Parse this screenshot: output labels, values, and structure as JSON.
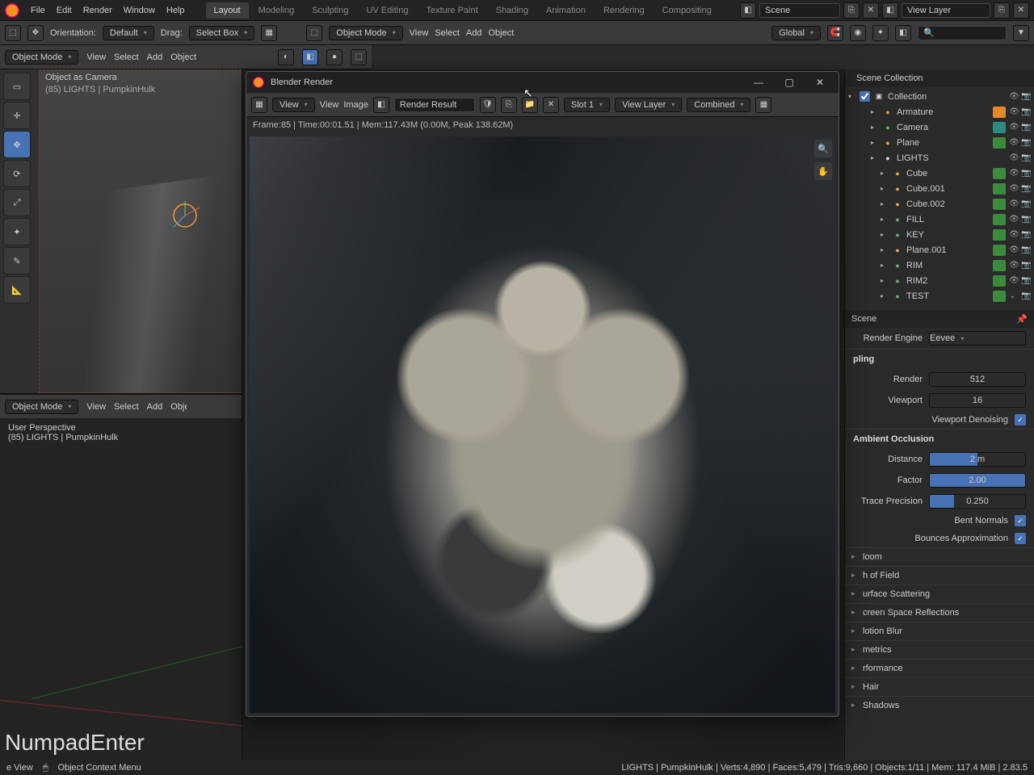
{
  "topmenu": {
    "file": "File",
    "edit": "Edit",
    "render": "Render",
    "window": "Window",
    "help": "Help"
  },
  "tabs": [
    "Layout",
    "Modeling",
    "Sculpting",
    "UV Editing",
    "Texture Paint",
    "Shading",
    "Animation",
    "Rendering",
    "Compositing"
  ],
  "scene_label": "Scene",
  "viewlayer_label": "View Layer",
  "header": {
    "orientation_label": "Orientation:",
    "default": "Default",
    "drag_label": "Drag:",
    "select_box": "Select Box",
    "object_mode": "Object Mode",
    "view": "View",
    "select": "Select",
    "add": "Add",
    "object": "Object",
    "global": "Global"
  },
  "modebar": {
    "object_mode": "Object Mode",
    "view": "View",
    "select": "Select",
    "add": "Add",
    "object": "Object"
  },
  "vp1": {
    "title": "Object as Camera",
    "sub": "(85) LIGHTS | PumpkinHulk"
  },
  "vp2": {
    "title": "User Perspective",
    "sub": "(85) LIGHTS | PumpkinHulk"
  },
  "key_indicator": "NumpadEnter",
  "render_window": {
    "title": "Blender Render",
    "view": "View",
    "view2": "View",
    "image": "Image",
    "render_result": "Render Result",
    "slot": "Slot 1",
    "layer": "View Layer",
    "pass": "Combined",
    "info": "Frame:85 | Time:00:01.51 | Mem:117.43M (0.00M, Peak 138.62M)"
  },
  "outliner": {
    "header": "Scene Collection",
    "collection": "Collection",
    "items": [
      {
        "name": "Armature",
        "icon": "arm",
        "indent": 2,
        "chip": "orange"
      },
      {
        "name": "Camera",
        "icon": "cam",
        "indent": 2,
        "chip": "teal"
      },
      {
        "name": "Plane",
        "icon": "mesh",
        "indent": 2,
        "chip": "green"
      },
      {
        "name": "LIGHTS",
        "icon": "coll",
        "indent": 2
      },
      {
        "name": "Cube",
        "icon": "mesh",
        "indent": 3,
        "chip": "green"
      },
      {
        "name": "Cube.001",
        "icon": "mesh",
        "indent": 3,
        "chip": "green"
      },
      {
        "name": "Cube.002",
        "icon": "mesh",
        "indent": 3,
        "chip": "green"
      },
      {
        "name": "FILL",
        "icon": "light",
        "indent": 3,
        "chip": "green"
      },
      {
        "name": "KEY",
        "icon": "light",
        "indent": 3,
        "chip": "green"
      },
      {
        "name": "Plane.001",
        "icon": "mesh",
        "indent": 3,
        "chip": "green"
      },
      {
        "name": "RIM",
        "icon": "light",
        "indent": 3,
        "chip": "green"
      },
      {
        "name": "RIM2",
        "icon": "light",
        "indent": 3,
        "chip": "green"
      },
      {
        "name": "TEST",
        "icon": "light",
        "indent": 3,
        "chip": "green"
      }
    ]
  },
  "props": {
    "scene": "Scene",
    "render_engine_label": "Render Engine",
    "render_engine": "Eevee",
    "sampling": "pling",
    "render_label": "Render",
    "render_val": "512",
    "viewport_label": "Viewport",
    "viewport_val": "16",
    "viewport_denoise": "Viewport Denoising",
    "ao": "Ambient Occlusion",
    "distance_label": "Distance",
    "distance_val": "2 m",
    "factor_label": "Factor",
    "factor_val": "2.00",
    "trace_label": "Trace Precision",
    "trace_val": "0.250",
    "bent": "Bent Normals",
    "bounces": "Bounces Approximation",
    "items": [
      "loom",
      "h of Field",
      "urface Scattering",
      "creen Space Reflections",
      "lotion Blur",
      "metrics",
      "rformance",
      "Hair",
      "Shadows"
    ]
  },
  "status": {
    "view": "e View",
    "context": "Object Context Menu",
    "right": "LIGHTS | PumpkinHulk | Verts:4,890 | Faces:5,479 | Tris:9,660 | Objects:1/11 | Mem: 117.4 MiB | 2.83.5"
  }
}
